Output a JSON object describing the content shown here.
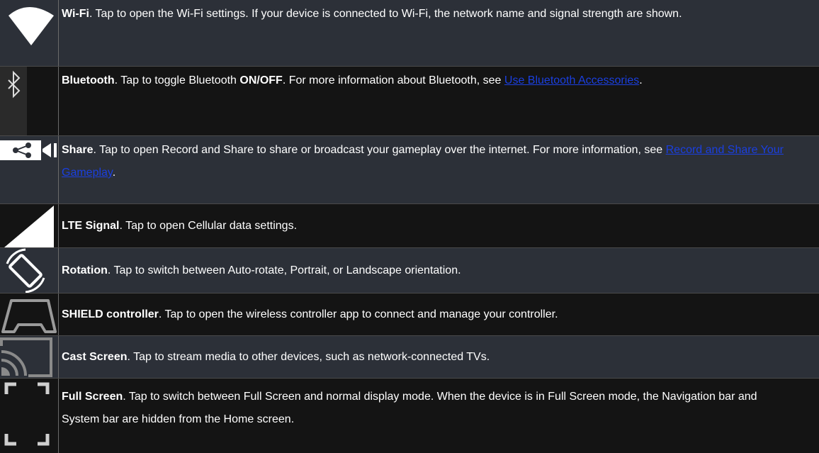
{
  "rows": [
    {
      "icon": "wifi-icon",
      "title": "Wi-Fi",
      "text": ". Tap to open the Wi-Fi settings. If your device is connected to Wi-Fi, the network name and signal strength are shown."
    },
    {
      "icon": "bluetooth-icon",
      "title": "Bluetooth",
      "text_a": ". Tap to toggle Bluetooth ",
      "bold2": "ON/OFF",
      "text_b": ". For more information about Bluetooth, see ",
      "link": "Use Bluetooth Accessories",
      "text_c": "."
    },
    {
      "icon": "share-icon",
      "title": "Share",
      "text_a": ". Tap to open Record and Share to share or broadcast your gameplay over the internet. For more information, see ",
      "link": "Record and Share Your Gameplay",
      "text_b": "."
    },
    {
      "icon": "lte-signal-icon",
      "title": "LTE Signal",
      "text": ". Tap to open Cellular data settings."
    },
    {
      "icon": "rotation-icon",
      "title": "Rotation",
      "text": ". Tap to switch between Auto-rotate, Portrait, or Landscape orientation."
    },
    {
      "icon": "controller-icon",
      "title": "SHIELD controller",
      "text": ". Tap to open the wireless controller app to connect and manage your controller."
    },
    {
      "icon": "cast-screen-icon",
      "title": "Cast Screen",
      "text": ". Tap to stream media to other devices, such as network-connected TVs."
    },
    {
      "icon": "full-screen-icon",
      "title": "Full Screen",
      "text": ". Tap to switch between Full Screen and normal display mode. When the device is in Full Screen mode, the Navigation bar and System bar are hidden from the Home screen."
    }
  ],
  "colors": {
    "row_dark": "#141414",
    "row_mid": "#2c3038",
    "link": "#1a3fe0",
    "text": "#ffffff"
  }
}
